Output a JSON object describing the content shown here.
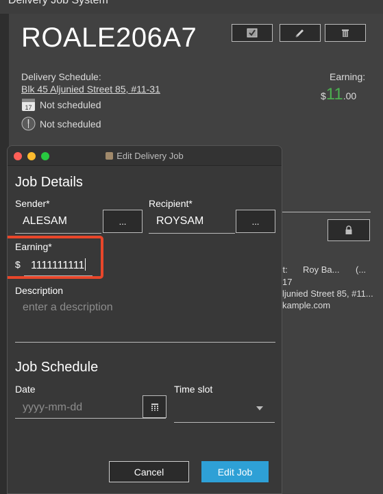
{
  "app": {
    "window_title": "Delivery Job System"
  },
  "job": {
    "id": "ROALE206A7",
    "schedule_label": "Delivery Schedule:",
    "address": "Blk 45 Aljunied Street 85, #11-31",
    "date_status": "Not scheduled",
    "time_status": "Not scheduled",
    "calendar_day": "17",
    "earning_label": "Earning:",
    "earning_currency": "$",
    "earning_whole": "11",
    "earning_cents": ".00",
    "peek": {
      "recipient_label": "ent:",
      "recipient_name": "Roy Ba...",
      "extra": "(...",
      "number": "17",
      "address": "ljunied Street 85, #11...",
      "email": "kample.com"
    }
  },
  "dialog": {
    "title": "Edit Delivery Job",
    "job_details_title": "Job Details",
    "sender_label": "Sender*",
    "sender_value": "ALESAM",
    "recipient_label": "Recipient*",
    "recipient_value": "ROYSAM",
    "ellipsis_label": "...",
    "earning_label": "Earning*",
    "currency": "$",
    "earning_value": "1111111111",
    "description_label": "Description",
    "description_placeholder": "enter a description",
    "job_schedule_title": "Job Schedule",
    "date_label": "Date",
    "date_placeholder": "yyyy-mm-dd",
    "timeslot_label": "Time slot",
    "timeslot_value": "",
    "cancel_label": "Cancel",
    "edit_label": "Edit Job"
  },
  "colors": {
    "accent": "#2ea0d6",
    "earning_green": "#4caf50",
    "highlight": "#e8462a"
  },
  "icons": [
    "check-icon",
    "edit-icon",
    "delete-icon",
    "calendar-icon",
    "clock-icon",
    "lock-icon",
    "calendar-picker-icon",
    "dropdown-chevron-icon"
  ]
}
